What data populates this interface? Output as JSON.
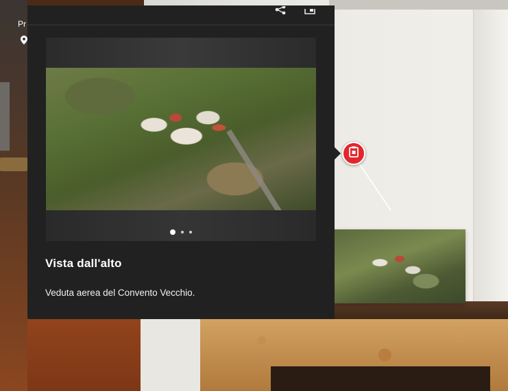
{
  "overlay": {
    "label_partial": "Pr"
  },
  "panel": {
    "title": "Vista dall'alto",
    "description": "Veduta aerea del Convento Vecchio.",
    "carousel": {
      "total_slides": 3,
      "active_index": 0
    }
  },
  "icons": {
    "share": "share-icon",
    "expand": "expand-icon",
    "hotspot": "clipboard-tag-icon",
    "location": "location-pin-icon"
  },
  "colors": {
    "panel_bg": "#212121",
    "hotspot_red": "#e3262b",
    "text_primary": "#ffffff"
  }
}
